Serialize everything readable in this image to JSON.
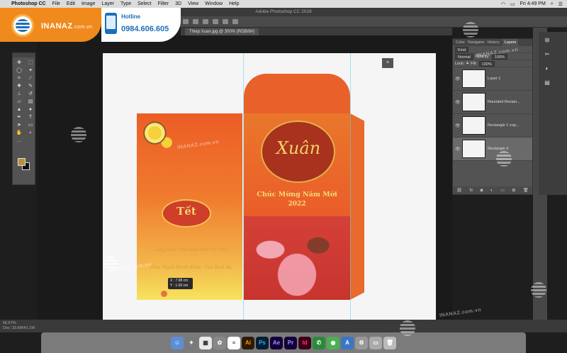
{
  "menubar": {
    "app": "Photoshop CC",
    "items": [
      "File",
      "Edit",
      "Image",
      "Layer",
      "Type",
      "Select",
      "Filter",
      "3D",
      "View",
      "Window",
      "Help"
    ],
    "clock": "Fri 4:49 PM"
  },
  "titlebar": "Adobe Photoshop CC 2018",
  "document_tab": "Thiep Xuan.jpg @ 300% (RGB/8#)",
  "canvas": {
    "xuan_text": "Xuân",
    "greeting": "Chúc Mừng Năm Mới",
    "year": "2022",
    "tet_text": "Tết",
    "wish_line_1": "Cung Chúc Tân Xuân Mọi Chỉ Nhớ",
    "wish_line_2": "Chúc Mạnh Mạnh Khỏe - Vạn Buổi An",
    "measure_x": "X : 7.98 cm",
    "measure_y": "Y : 1.02 cm"
  },
  "layers_panel": {
    "tabs": [
      "Color",
      "Navigator",
      "History",
      "Layers"
    ],
    "active_tab": "Layers",
    "kind": "Kind",
    "blend_mode": "Normal",
    "opacity_label": "Opacity:",
    "opacity": "100%",
    "lock_label": "Lock:",
    "fill_label": "Fill:",
    "fill": "100%",
    "layers": [
      {
        "name": "Layer 1"
      },
      {
        "name": "Rounded Rectan..."
      },
      {
        "name": "Rectangle 1 cop..."
      },
      {
        "name": "Rectangle 3"
      }
    ]
  },
  "status": {
    "zoom": "66.67%",
    "doc_size": "Doc: 33.6M/41.1M"
  },
  "brand": {
    "name": "INANAZ",
    "domain": ".com.vn",
    "hotline_label": "Hotline",
    "hotline_number": "0984.606.605",
    "watermark": "INANAZ.com.vn"
  },
  "dock": {
    "apps": [
      {
        "label": "Ai",
        "color": "#2e1a05",
        "fg": "#ff9a00"
      },
      {
        "label": "Ps",
        "color": "#061e2f",
        "fg": "#31a8ff"
      },
      {
        "label": "Ae",
        "color": "#14003a",
        "fg": "#9999ff"
      },
      {
        "label": "Pr",
        "color": "#14003a",
        "fg": "#9999ff"
      },
      {
        "label": "Id",
        "color": "#3b0016",
        "fg": "#ff3366"
      }
    ]
  },
  "colors": {
    "accent_orange": "#f08a1c",
    "brand_blue": "#1b6fb8",
    "envelope_red": "#e9612a",
    "gold": "#f5dc79"
  }
}
